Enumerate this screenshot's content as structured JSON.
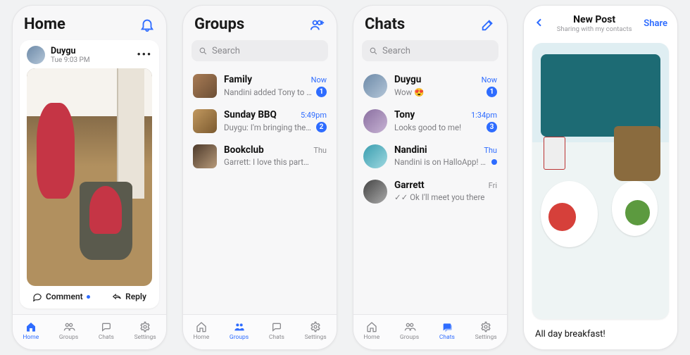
{
  "accent": "#2e6cff",
  "tabs": {
    "home": "Home",
    "groups": "Groups",
    "chats": "Chats",
    "settings": "Settings"
  },
  "search_placeholder": "Search",
  "home": {
    "title": "Home",
    "post": {
      "author": "Duygu",
      "time": "Tue 9:03 PM",
      "comment_label": "Comment",
      "reply_label": "Reply"
    }
  },
  "groups": {
    "title": "Groups",
    "items": [
      {
        "name": "Family",
        "sub": "Nandini added Tony to the group",
        "time": "Now",
        "time_accent": true,
        "badge": "1"
      },
      {
        "name": "Sunday BBQ",
        "sub": "Duygu: I'm bringing these!",
        "time": "5:49pm",
        "time_accent": true,
        "badge": "2"
      },
      {
        "name": "Bookclub",
        "sub": "Garrett: I love this part…",
        "time": "Thu",
        "time_accent": false
      }
    ]
  },
  "chats": {
    "title": "Chats",
    "items": [
      {
        "name": "Duygu",
        "sub": "Wow 😍",
        "time": "Now",
        "time_accent": true,
        "badge": "1"
      },
      {
        "name": "Tony",
        "sub": "Looks good to me!",
        "time": "1:34pm",
        "time_accent": true,
        "badge": "3"
      },
      {
        "name": "Nandini",
        "sub": "Nandini is on HalloApp! 🎉",
        "time": "Thu",
        "time_accent": true,
        "dot": true
      },
      {
        "name": "Garrett",
        "sub": "✓✓ Ok I'll meet you there",
        "time": "Fri",
        "time_accent": false
      }
    ]
  },
  "newpost": {
    "title": "New Post",
    "subtitle": "Sharing with my contacts",
    "share": "Share",
    "caption": "All day breakfast!"
  }
}
